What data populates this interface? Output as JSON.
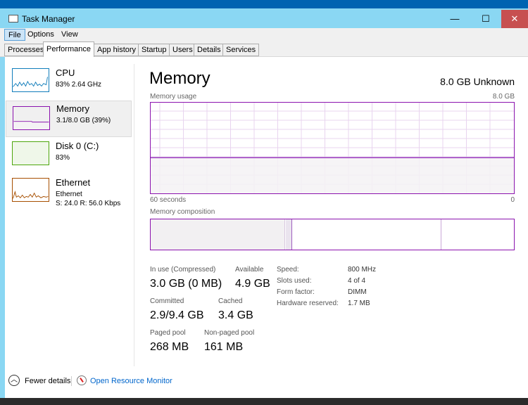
{
  "window": {
    "title": "Task Manager",
    "minimize": "—",
    "maximize": "☐",
    "close": "✕"
  },
  "menu": [
    "File",
    "Options",
    "View"
  ],
  "tabs": [
    "Processes",
    "Performance",
    "App history",
    "Startup",
    "Users",
    "Details",
    "Services"
  ],
  "sidebar": [
    {
      "name": "CPU",
      "sub": "83%  2.64 GHz",
      "color": "#117dbb"
    },
    {
      "name": "Memory",
      "sub": "3.1/8.0 GB (39%)",
      "color": "#8b12ae"
    },
    {
      "name": "Disk 0 (C:)",
      "sub": "83%",
      "color": "#4da60c"
    },
    {
      "name": "Ethernet",
      "sub": "Ethernet",
      "sub2": "S: 24.0  R: 56.0 Kbps",
      "color": "#a74f01"
    }
  ],
  "main": {
    "title": "Memory",
    "capacity": "8.0 GB Unknown",
    "usage_label": "Memory usage",
    "usage_max": "8.0 GB",
    "time_left": "60 seconds",
    "time_right": "0",
    "usage_fraction": 0.39,
    "composition_label": "Memory composition",
    "stats": {
      "in_use_label": "In use (Compressed)",
      "in_use": "3.0 GB (0 MB)",
      "available_label": "Available",
      "available": "4.9 GB",
      "committed_label": "Committed",
      "committed": "2.9/9.4 GB",
      "cached_label": "Cached",
      "cached": "3.4 GB",
      "paged_label": "Paged pool",
      "paged": "268 MB",
      "nonpaged_label": "Non-paged pool",
      "nonpaged": "161 MB"
    },
    "details": [
      {
        "k": "Speed:",
        "v": "800 MHz"
      },
      {
        "k": "Slots used:",
        "v": "4 of 4"
      },
      {
        "k": "Form factor:",
        "v": "DIMM"
      },
      {
        "k": "Hardware reserved:",
        "v": "1.7 MB"
      }
    ]
  },
  "footer": {
    "fewer": "Fewer details",
    "monitor": "Open Resource Monitor"
  },
  "colors": {
    "memory": "#8b12ae",
    "link": "#0066cc",
    "close": "#c75050"
  }
}
